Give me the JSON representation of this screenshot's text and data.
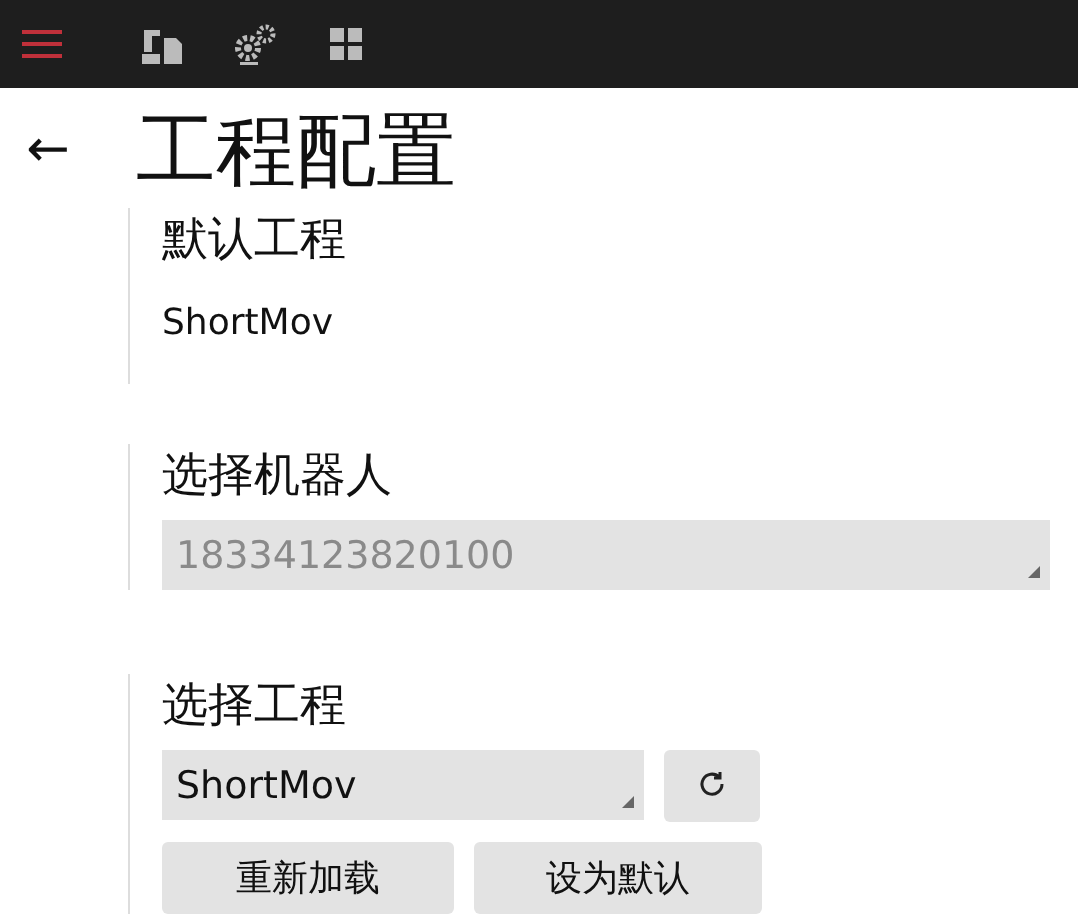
{
  "page": {
    "back": "←",
    "title": "工程配置"
  },
  "default_project": {
    "label": "默认工程",
    "value": "ShortMov"
  },
  "robot": {
    "label": "选择机器人",
    "value": "18334123820100",
    "disabled": true
  },
  "project": {
    "label": "选择工程",
    "value": "ShortMov",
    "disabled": false
  },
  "buttons": [
    "重新加载",
    "设为默认"
  ]
}
